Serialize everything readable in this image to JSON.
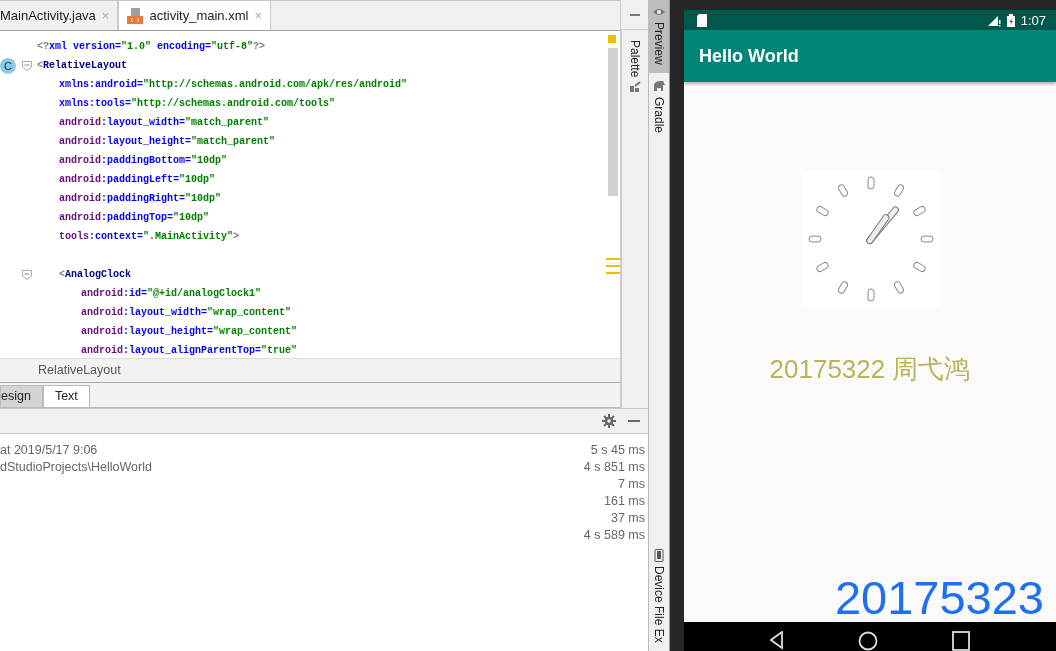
{
  "editor_tabs": [
    {
      "label": "MainActivity.java",
      "close": "×",
      "selected": false
    },
    {
      "label": "activity_main.xml",
      "close": "×",
      "selected": true
    }
  ],
  "code": [
    {
      "tokens": [
        {
          "text": "<?",
          "kind": "punct"
        },
        {
          "text": "xml",
          "kind": "attr"
        },
        {
          "text": " version=",
          "kind": "attr"
        },
        {
          "text": "\"1.0\"",
          "kind": "value"
        },
        {
          "text": " encoding=",
          "kind": "attr"
        },
        {
          "text": "\"utf-8\"",
          "kind": "value"
        },
        {
          "text": "?>",
          "kind": "punct"
        }
      ]
    },
    {
      "foldable": true,
      "gutter_badge": "C",
      "tokens": [
        {
          "text": "<",
          "kind": "punct"
        },
        {
          "text": "RelativeLayout",
          "kind": "tag"
        }
      ],
      "children": [
        {
          "tokens": [
            {
              "text": "xmlns:android=",
              "kind": "attr"
            },
            {
              "text": "\"http://schemas.android.com/apk/res/android\"",
              "kind": "value"
            }
          ]
        },
        {
          "tokens": [
            {
              "text": "xmlns:tools=",
              "kind": "attr"
            },
            {
              "text": "\"http://schemas.android.com/tools\"",
              "kind": "value"
            }
          ]
        },
        {
          "tokens": [
            {
              "text": "android",
              "kind": "ns"
            },
            {
              "text": ":layout_width=",
              "kind": "attr"
            },
            {
              "text": "\"match_parent\"",
              "kind": "value"
            }
          ]
        },
        {
          "tokens": [
            {
              "text": "android",
              "kind": "ns"
            },
            {
              "text": ":layout_height=",
              "kind": "attr"
            },
            {
              "text": "\"match_parent\"",
              "kind": "value"
            }
          ]
        },
        {
          "tokens": [
            {
              "text": "android",
              "kind": "ns"
            },
            {
              "text": ":paddingBottom=",
              "kind": "attr"
            },
            {
              "text": "\"10dp\"",
              "kind": "value"
            }
          ]
        },
        {
          "tokens": [
            {
              "text": "android",
              "kind": "ns"
            },
            {
              "text": ":paddingLeft=",
              "kind": "attr"
            },
            {
              "text": "\"10dp\"",
              "kind": "value"
            }
          ]
        },
        {
          "tokens": [
            {
              "text": "android",
              "kind": "ns"
            },
            {
              "text": ":paddingRight=",
              "kind": "attr"
            },
            {
              "text": "\"10dp\"",
              "kind": "value"
            }
          ]
        },
        {
          "tokens": [
            {
              "text": "android",
              "kind": "ns"
            },
            {
              "text": ":paddingTop=",
              "kind": "attr"
            },
            {
              "text": "\"10dp\"",
              "kind": "value"
            }
          ]
        },
        {
          "tokens": [
            {
              "text": "tools",
              "kind": "ns"
            },
            {
              "text": ":context=",
              "kind": "attr"
            },
            {
              "text": "\".MainActivity\"",
              "kind": "value"
            },
            {
              "text": ">",
              "kind": "punct"
            }
          ]
        },
        {
          "kind": "blank"
        },
        {
          "foldable": true,
          "tokens": [
            {
              "text": "<",
              "kind": "punct"
            },
            {
              "text": "AnalogClock",
              "kind": "tag"
            }
          ],
          "children": [
            {
              "tokens": [
                {
                  "text": "android",
                  "kind": "ns"
                },
                {
                  "text": ":id=",
                  "kind": "attr"
                },
                {
                  "text": "\"@+id/analogClock1\"",
                  "kind": "value"
                }
              ]
            },
            {
              "tokens": [
                {
                  "text": "android",
                  "kind": "ns"
                },
                {
                  "text": ":layout_width=",
                  "kind": "attr"
                },
                {
                  "text": "\"wrap_content\"",
                  "kind": "value"
                }
              ]
            },
            {
              "tokens": [
                {
                  "text": "android",
                  "kind": "ns"
                },
                {
                  "text": ":layout_height=",
                  "kind": "attr"
                },
                {
                  "text": "\"wrap_content\"",
                  "kind": "value"
                }
              ]
            },
            {
              "tokens": [
                {
                  "text": "android",
                  "kind": "ns"
                },
                {
                  "text": ":layout_alignParentTop=",
                  "kind": "attr"
                },
                {
                  "text": "\"true\"",
                  "kind": "value"
                }
              ]
            }
          ]
        }
      ]
    }
  ],
  "breadcrumb": "RelativeLayout",
  "view_tabs": [
    {
      "label": "esign",
      "selected": false
    },
    {
      "label": "Text",
      "selected": true
    }
  ],
  "build_log": [
    {
      "message": "at 2019/5/17 9:06",
      "duration": "5 s 45 ms"
    },
    {
      "message": "dStudioProjects\\HelloWorld",
      "duration": "4 s 851 ms"
    },
    {
      "duration": "7 ms"
    },
    {
      "duration": "161 ms"
    },
    {
      "duration": "37 ms"
    },
    {
      "duration": "4 s 589 ms"
    }
  ],
  "side_tool_windows": [
    {
      "label": "Palette"
    }
  ],
  "right_tool_windows_top": [
    {
      "label": "Preview",
      "selected": true
    },
    {
      "label": "Gradle",
      "selected": false
    }
  ],
  "right_tool_windows_bottom": [
    {
      "label": "Device File Ex",
      "selected": false
    }
  ],
  "phone": {
    "status_time": "1:07",
    "app_title": "Hello World",
    "text": "20175322 周弋鸿"
  },
  "overlay_text": "20175323"
}
